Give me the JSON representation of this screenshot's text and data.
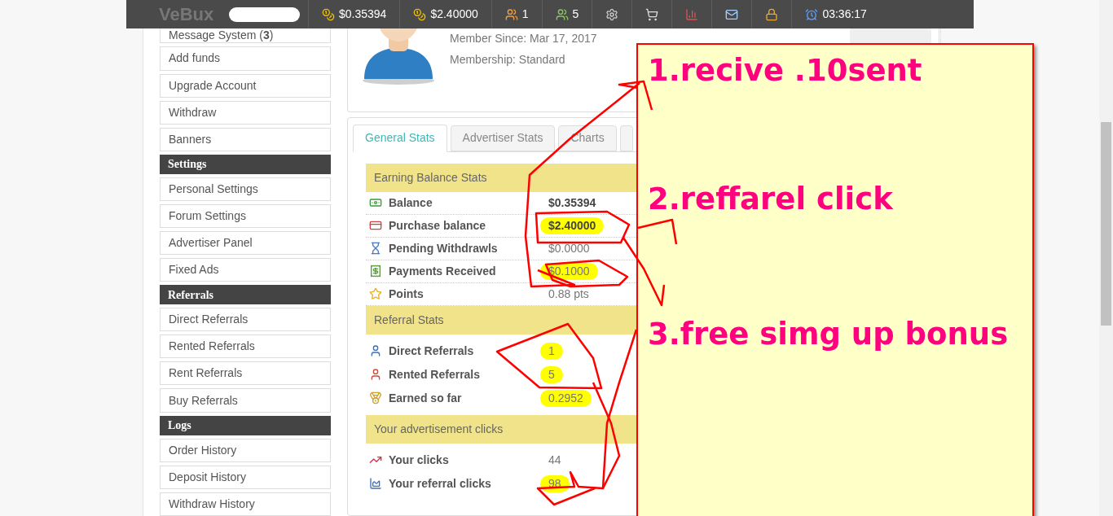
{
  "topbar": {
    "logo": "VeBux",
    "items": [
      {
        "kind": "coins",
        "text": "$0.35394"
      },
      {
        "kind": "coins-plus",
        "text": "$2.40000"
      },
      {
        "kind": "users",
        "text": "1"
      },
      {
        "kind": "users-rented",
        "text": "5"
      },
      {
        "kind": "settings"
      },
      {
        "kind": "cart"
      },
      {
        "kind": "chart"
      },
      {
        "kind": "mail"
      },
      {
        "kind": "lock"
      },
      {
        "kind": "clock",
        "text": "03:36:17"
      }
    ]
  },
  "sidebar": [
    {
      "kind": "item",
      "label": "Message System (**3**)"
    },
    {
      "kind": "item",
      "label": "Add funds"
    },
    {
      "kind": "item",
      "label": "Upgrade Account"
    },
    {
      "kind": "item",
      "label": "Withdraw"
    },
    {
      "kind": "item",
      "label": "Banners"
    },
    {
      "kind": "header",
      "label": "Settings"
    },
    {
      "kind": "item",
      "label": "Personal Settings"
    },
    {
      "kind": "item",
      "label": "Forum Settings"
    },
    {
      "kind": "item",
      "label": "Advertiser Panel"
    },
    {
      "kind": "item",
      "label": "Fixed Ads"
    },
    {
      "kind": "header",
      "label": "Referrals"
    },
    {
      "kind": "item",
      "label": "Direct Referrals"
    },
    {
      "kind": "item",
      "label": "Rented Referrals"
    },
    {
      "kind": "item",
      "label": "Rent Referrals"
    },
    {
      "kind": "item",
      "label": "Buy Referrals"
    },
    {
      "kind": "header",
      "label": "Logs"
    },
    {
      "kind": "item",
      "label": "Order History"
    },
    {
      "kind": "item",
      "label": "Deposit History"
    },
    {
      "kind": "item",
      "label": "Withdraw History"
    }
  ],
  "profile": {
    "member_since": "Member Since: Mar 17, 2017",
    "membership": "Membership: Standard"
  },
  "tabs": [
    {
      "label": "General Stats",
      "selected": true
    },
    {
      "label": "Advertiser Stats",
      "selected": false
    },
    {
      "label": "Charts",
      "selected": false
    }
  ],
  "sections": [
    {
      "title": "Earning Balance Stats",
      "rows": [
        {
          "label": "Balance",
          "value": "$0.35394",
          "bold": true,
          "highlighted": false
        },
        {
          "label": "Purchase balance",
          "value": "$2.40000",
          "bold": true,
          "highlighted": true
        },
        {
          "label": "Pending Withdrawls",
          "value": "$0.0000",
          "bold": false,
          "highlighted": false
        },
        {
          "label": "Payments Received",
          "value": "$0.1000",
          "bold": false,
          "highlighted": true
        },
        {
          "label": "Points",
          "value": "0.88 pts",
          "bold": false,
          "highlighted": false
        }
      ]
    },
    {
      "title": "Referral Stats",
      "rows": [
        {
          "label": "Direct Referrals",
          "value": "1",
          "bold": false,
          "highlighted": true
        },
        {
          "label": "Rented Referrals",
          "value": "5",
          "bold": false,
          "highlighted": true
        },
        {
          "label": "Earned so far",
          "value": "0.2952",
          "bold": false,
          "highlighted": true
        }
      ]
    },
    {
      "title": "Your advertisement clicks",
      "rows": [
        {
          "label": "Your clicks",
          "value": "44",
          "bold": false,
          "highlighted": false
        },
        {
          "label": "Your referral clicks",
          "value": "98",
          "bold": false,
          "highlighted": true
        }
      ]
    }
  ],
  "note": {
    "lines": [
      "1.recive .10sent",
      "2.reffarel click",
      "3.free simg up bonus"
    ]
  }
}
